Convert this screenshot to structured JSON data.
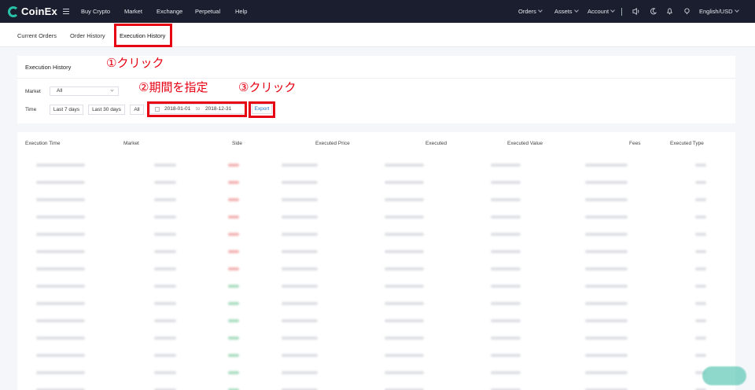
{
  "nav": {
    "brand": "CoinEx",
    "items": [
      "Buy Crypto",
      "Market",
      "Exchange",
      "Perpetual",
      "Help"
    ],
    "right": {
      "orders": "Orders",
      "assets": "Assets",
      "account": "Account",
      "language": "English/USD"
    }
  },
  "tabs": [
    "Current Orders",
    "Order History",
    "Execution History"
  ],
  "filter": {
    "title": "Execution History",
    "market_label": "Market",
    "market_value": "All",
    "time_label": "Time",
    "buttons": [
      "Last 7 days",
      "Last 30 days",
      "All"
    ],
    "date_from": "2018-01-01",
    "date_to_word": "to",
    "date_to": "2018-12-31",
    "export": "Export"
  },
  "table": {
    "columns": [
      "Execution Time",
      "Market",
      "Side",
      "Executed Price",
      "Executed",
      "Executed Value",
      "Fees",
      "Executed Type"
    ],
    "row_sides": [
      "sell",
      "sell",
      "sell",
      "sell",
      "sell",
      "sell",
      "sell",
      "buy",
      "buy",
      "buy",
      "buy",
      "buy",
      "buy",
      "buy"
    ]
  },
  "annotations": {
    "step1": "①クリック",
    "step2": "②期間を指定",
    "step3": "③クリック"
  },
  "colors": {
    "annotation": "#e60012",
    "brand": "#27c2a8",
    "nav_bg": "#1b1e2e"
  }
}
